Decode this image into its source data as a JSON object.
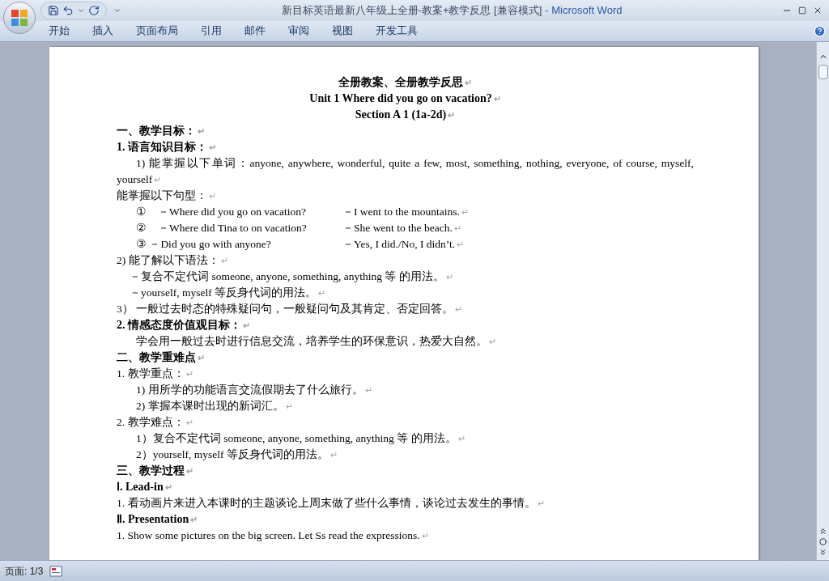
{
  "window": {
    "title": "新目标英语最新八年级上全册-教案+教学反思 [兼容模式]",
    "app": "- Microsoft Word"
  },
  "ribbon_tabs": [
    {
      "label": "开始",
      "selected": false
    },
    {
      "label": "插入",
      "selected": false
    },
    {
      "label": "页面布局",
      "selected": false
    },
    {
      "label": "引用",
      "selected": false
    },
    {
      "label": "邮件",
      "selected": false
    },
    {
      "label": "审阅",
      "selected": false
    },
    {
      "label": "视图",
      "selected": false
    },
    {
      "label": "开发工具",
      "selected": false
    }
  ],
  "document": {
    "paragraphs": [
      {
        "kind": "title",
        "text": "全册教案、全册教学反思",
        "end": "↵"
      },
      {
        "kind": "title",
        "text": "Unit 1 Where did you go on vacation?",
        "end": "↵"
      },
      {
        "kind": "title",
        "text": "Section A 1 (1a-2d)",
        "end": "↵"
      },
      {
        "kind": "heading",
        "text": "一、教学目标：",
        "end": "↵"
      },
      {
        "kind": "heading",
        "text": "1. 语言知识目标：",
        "end": "↵"
      },
      {
        "kind": "body-first",
        "text": "1) 能掌握以下单词：anyone, anywhere, wonderful, quite a few, most, something, nothing, everyone, of course, myself, yourself",
        "end": "↵"
      },
      {
        "kind": "body",
        "text": "能掌握以下句型：",
        "end": "↵"
      },
      {
        "kind": "pair",
        "text": "①　－Where did you go on vacation?",
        "answer": "－I went to the mountains.",
        "end": "↵"
      },
      {
        "kind": "pair",
        "text": "②　－Where did Tina to on vacation?",
        "answer": "－She went to the beach.",
        "end": "↵"
      },
      {
        "kind": "pair",
        "text": "③ －Did you go with anyone?",
        "answer": "－Yes, I did./No, I didn’t.",
        "end": "↵"
      },
      {
        "kind": "body",
        "text": "2) 能了解以下语法：",
        "end": "↵"
      },
      {
        "kind": "body-half",
        "text": "－复合不定代词 someone, anyone, something, anything 等 的用法。",
        "end": "↵"
      },
      {
        "kind": "body-half",
        "text": "－yourself, myself 等反身代词的用法。",
        "end": "↵"
      },
      {
        "kind": "body",
        "text": "3） 一般过去时态的特殊疑问句，一般疑问句及其肯定、否定回答。",
        "end": "↵"
      },
      {
        "kind": "heading",
        "text": "2. 情感态度价值观目标：",
        "end": "↵"
      },
      {
        "kind": "body-indent",
        "text": "学会用一般过去时进行信息交流，培养学生的环保意识，热爱大自然。",
        "end": "↵"
      },
      {
        "kind": "heading",
        "text": "二、教学重难点",
        "end": "↵"
      },
      {
        "kind": "body",
        "text": "1. 教学重点：",
        "end": "↵"
      },
      {
        "kind": "body-indent",
        "text": "1) 用所学的功能语言交流假期去了什么旅行。",
        "end": "↵"
      },
      {
        "kind": "body-indent",
        "text": "2) 掌握本课时出现的新词汇。",
        "end": "↵"
      },
      {
        "kind": "body",
        "text": "2. 教学难点：",
        "end": "↵"
      },
      {
        "kind": "body-indent",
        "text": "1）复合不定代词 someone, anyone, something, anything 等 的用法。",
        "end": "↵"
      },
      {
        "kind": "body-indent",
        "text": "2）yourself, myself 等反身代词的用法。",
        "end": "↵"
      },
      {
        "kind": "heading",
        "text": "三、教学过程",
        "end": "↵"
      },
      {
        "kind": "heading",
        "text": "Ⅰ. Lead-in",
        "end": "↵"
      },
      {
        "kind": "body",
        "text": "1. 看动画片来进入本课时的主题谈论上周末做了些什么事情，谈论过去发生的事情。",
        "end": "↵"
      },
      {
        "kind": "heading",
        "text": "Ⅱ. Presentation",
        "end": "↵"
      },
      {
        "kind": "body",
        "text": "1. Show some pictures on the big screen. Let Ss read the expressions.",
        "end": "↵"
      }
    ]
  },
  "status_bar": {
    "page": "页面: 1/3"
  }
}
